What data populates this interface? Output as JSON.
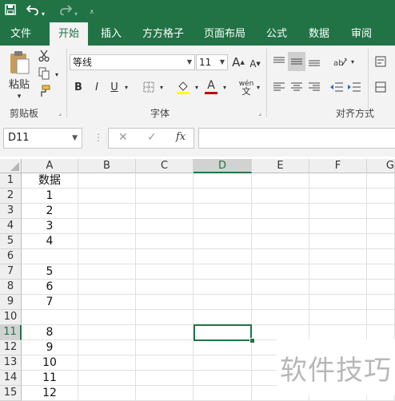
{
  "quick_access": {
    "save_icon": "save-icon",
    "undo_icon": "undo-icon",
    "redo_icon": "redo-icon",
    "customize_icon": "customize-icon"
  },
  "tabs": [
    {
      "label": "文件"
    },
    {
      "label": "开始",
      "active": true
    },
    {
      "label": "插入"
    },
    {
      "label": "方方格子"
    },
    {
      "label": "页面布局"
    },
    {
      "label": "公式"
    },
    {
      "label": "数据"
    },
    {
      "label": "审阅"
    }
  ],
  "ribbon": {
    "clipboard": {
      "paste_label": "粘贴",
      "group_label": "剪贴板"
    },
    "font": {
      "font_name": "等线",
      "font_size": "11",
      "bold": "B",
      "italic": "I",
      "underline": "U",
      "group_label": "字体",
      "grow": "A",
      "shrink": "A",
      "font_color_glyph": "A",
      "fill_glyph": "◇",
      "phonetic_top": "wén",
      "phonetic_bottom": "文"
    },
    "alignment": {
      "group_label": "对齐方式"
    }
  },
  "formula_bar": {
    "name_box": "D11",
    "cancel": "✕",
    "enter": "✓",
    "fx": "fx",
    "formula": ""
  },
  "sheet": {
    "columns": [
      "A",
      "B",
      "C",
      "D",
      "E",
      "F",
      "G"
    ],
    "selected_column": "D",
    "selected_row": "11",
    "rows": [
      {
        "num": "1",
        "a": "数据"
      },
      {
        "num": "2",
        "a": "1"
      },
      {
        "num": "3",
        "a": "2"
      },
      {
        "num": "4",
        "a": "3"
      },
      {
        "num": "5",
        "a": "4"
      },
      {
        "num": "6",
        "a": ""
      },
      {
        "num": "7",
        "a": "5"
      },
      {
        "num": "8",
        "a": "6"
      },
      {
        "num": "9",
        "a": "7"
      },
      {
        "num": "10",
        "a": ""
      },
      {
        "num": "11",
        "a": "8"
      },
      {
        "num": "12",
        "a": "9"
      },
      {
        "num": "13",
        "a": "10"
      },
      {
        "num": "14",
        "a": "11"
      },
      {
        "num": "15",
        "a": "12"
      }
    ]
  },
  "watermark": {
    "text": "软件技巧"
  },
  "colors": {
    "accent": "#217346",
    "ribbon_bg": "#f3f3f3",
    "grid_line": "#e1e1e1"
  }
}
